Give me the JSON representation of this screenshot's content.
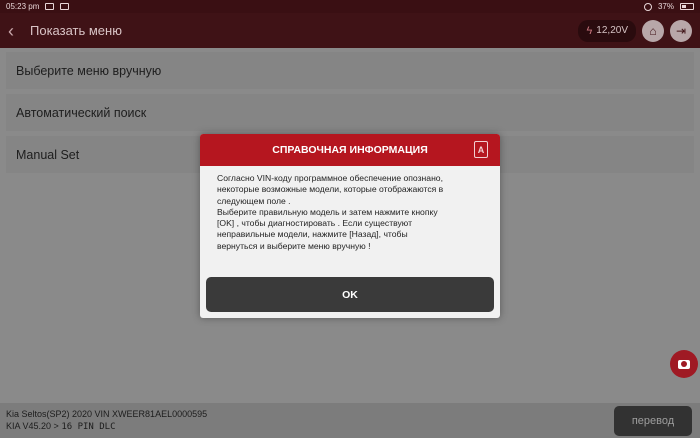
{
  "status_bar": {
    "time": "05:23 pm",
    "battery": "37%"
  },
  "header": {
    "title": "Показать меню",
    "voltage": "12,20V",
    "voltage_icon": "bolt-icon",
    "home_icon": "home-icon",
    "exit_icon": "exit-icon"
  },
  "menu": {
    "items": [
      {
        "label": "Выберите меню вручную"
      },
      {
        "label": "Автоматический поиск"
      },
      {
        "label": "Manual Set"
      }
    ]
  },
  "dialog": {
    "title": "СПРАВОЧНАЯ ИНФОРМАЦИЯ",
    "line1": "Согласно VIN-коду программное обеспечение опознано,",
    "line2": "некоторые возможные модели, которые отображаются в",
    "line3": "следующем поле .",
    "line4": "Выберите правильную модель и затем нажмите кнопку",
    "line5": "[OK] , чтобы диагностировать . Если существуют",
    "line6": "неправильные модели, нажмите [Назад], чтобы",
    "line7": "вернуться и выберите меню вручную !",
    "ok_label": "OK"
  },
  "footer": {
    "vehicle_line": "Kia  Seltos(SP2)  2020  VIN  XWEER81AEL0000595",
    "path_prefix": "KIA V45.20 >",
    "path_suffix": "16 PIN DLC",
    "translate_label": "перевод"
  },
  "colors": {
    "title_bar": "#3f1216",
    "dialog_header": "#b5161f",
    "camera_button": "#9f1a24"
  }
}
